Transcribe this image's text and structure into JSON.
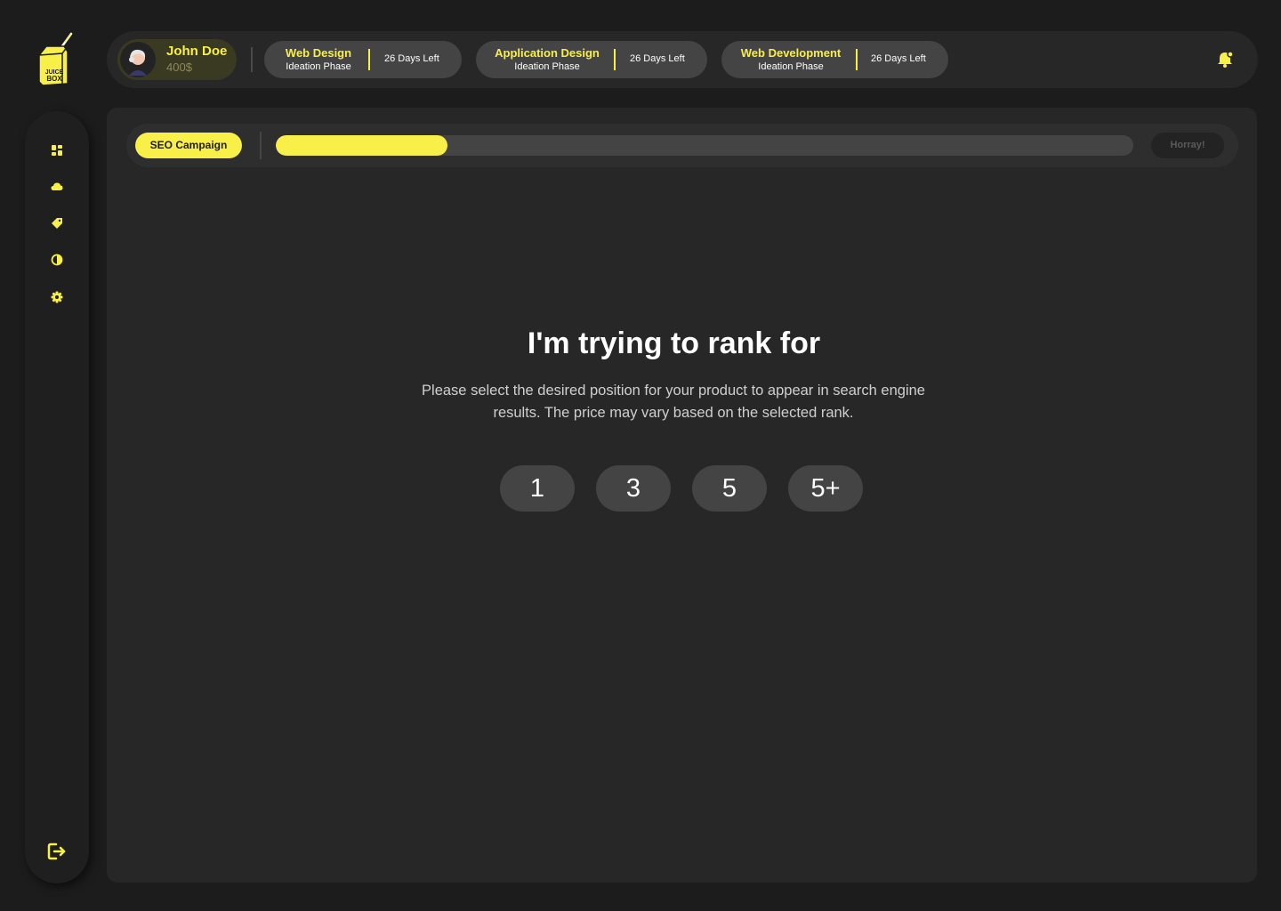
{
  "brand": {
    "logo_text": "JUICE BOX"
  },
  "user": {
    "name": "John Doe",
    "balance": "400$"
  },
  "projects": [
    {
      "title": "Web Design",
      "phase": "Ideation Phase",
      "days_left": "26 Days Left"
    },
    {
      "title": "Application Design",
      "phase": "Ideation Phase",
      "days_left": "26 Days Left"
    },
    {
      "title": "Web Development",
      "phase": "Ideation Phase",
      "days_left": "26 Days Left"
    }
  ],
  "sidebar": {
    "items": [
      {
        "icon": "dashboard-icon"
      },
      {
        "icon": "cloud-icon"
      },
      {
        "icon": "tag-icon"
      },
      {
        "icon": "contrast-icon"
      },
      {
        "icon": "gear-icon"
      }
    ],
    "logout_icon": "logout-icon"
  },
  "campaign": {
    "label": "SEO Campaign",
    "progress": 0.2,
    "status_label": "Horray!"
  },
  "main": {
    "heading": "I'm trying to rank for",
    "description": "Please select the desired position for your product to appear in search engine results. The price may vary based on the selected rank.",
    "rank_options": [
      "1",
      "3",
      "5",
      "5+"
    ]
  },
  "colors": {
    "accent": "#f9ef49",
    "background": "#1c1c1c",
    "panel": "#272727",
    "pill": "#444444"
  }
}
